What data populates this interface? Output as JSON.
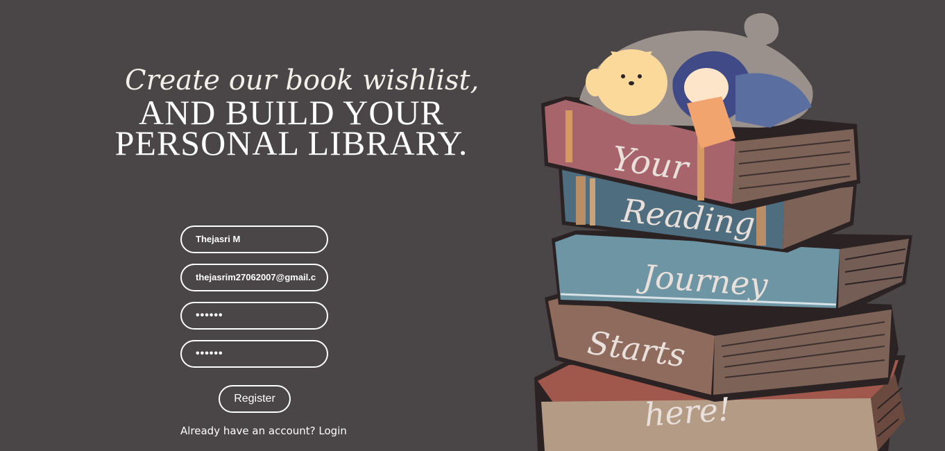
{
  "heading": {
    "script_line": "Create our book wishlist,",
    "caps_line_1": "AND BUILD YOUR",
    "caps_line_2": "PERSONAL LIBRARY."
  },
  "form": {
    "name_value": "Thejasri M",
    "email_value": "thejasrim27062007@gmail.c",
    "password_value": "••••••",
    "confirm_password_value": "••••••",
    "register_label": "Register"
  },
  "footer": {
    "prompt": "Already have an account?",
    "login_label": "Login"
  },
  "illustration": {
    "words": [
      "Your",
      "Reading",
      "Journey",
      "Starts",
      "here!"
    ]
  },
  "colors": {
    "background": "#4a4547",
    "text": "#ffffff",
    "book_red": "#a8646b",
    "book_blue_dark": "#4e6e80",
    "book_blue_light": "#6d95a3",
    "book_brown": "#8c6a5a",
    "book_tan": "#b89a86"
  }
}
